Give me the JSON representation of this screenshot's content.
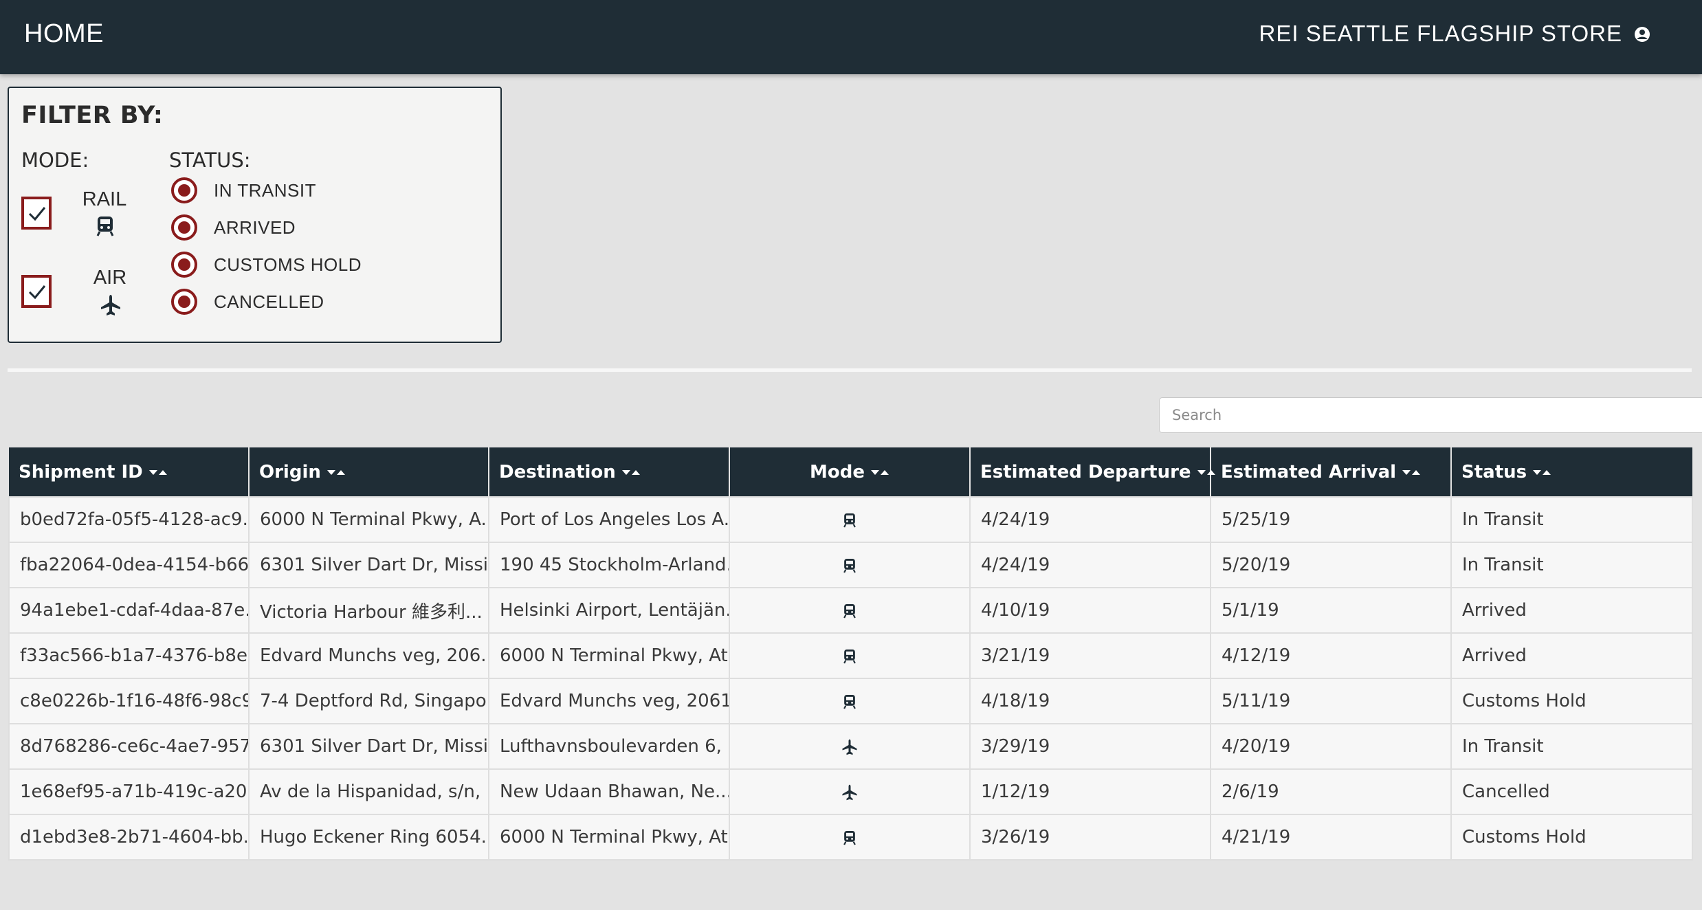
{
  "header": {
    "home_label": "HOME",
    "store_name": "REI SEATTLE FLAGSHIP STORE",
    "user_icon": "user-circle-icon"
  },
  "filter": {
    "title": "FILTER BY:",
    "mode_label": "MODE:",
    "status_label": "STATUS:",
    "modes": [
      {
        "label": "RAIL",
        "icon": "train-icon",
        "checked": true
      },
      {
        "label": "AIR",
        "icon": "airplane-icon",
        "checked": true
      }
    ],
    "statuses": [
      {
        "label": "IN TRANSIT",
        "selected": true
      },
      {
        "label": "ARRIVED",
        "selected": true
      },
      {
        "label": "CUSTOMS HOLD",
        "selected": true
      },
      {
        "label": "CANCELLED",
        "selected": true
      }
    ],
    "accent_color": "#8a1c1c"
  },
  "search": {
    "placeholder": "Search",
    "value": ""
  },
  "table": {
    "columns": [
      "Shipment ID",
      "Origin",
      "Destination",
      "Mode",
      "Estimated Departure",
      "Estimated Arrival",
      "Status"
    ],
    "header_color": "#1f2d36",
    "rows": [
      {
        "id": "b0ed72fa-05f5-4128-ac9...",
        "origin": "6000 N Terminal Pkwy, A...",
        "destination": "Port of Los Angeles Los A...",
        "mode": "rail",
        "departure": "4/24/19",
        "arrival": "5/25/19",
        "status": "In Transit"
      },
      {
        "id": "fba22064-0dea-4154-b66...",
        "origin": "6301 Silver Dart Dr, Missi...",
        "destination": "190 45 Stockholm-Arland...",
        "mode": "rail",
        "departure": "4/24/19",
        "arrival": "5/20/19",
        "status": "In Transit"
      },
      {
        "id": "94a1ebe1-cdaf-4daa-87e...",
        "origin": "Victoria Harbour 維多利...",
        "destination": "Helsinki Airport, Lentäjän...",
        "mode": "rail",
        "departure": "4/10/19",
        "arrival": "5/1/19",
        "status": "Arrived"
      },
      {
        "id": "f33ac566-b1a7-4376-b8e...",
        "origin": "Edvard Munchs veg, 206...",
        "destination": "6000 N Terminal Pkwy, At...",
        "mode": "rail",
        "departure": "3/21/19",
        "arrival": "4/12/19",
        "status": "Arrived"
      },
      {
        "id": "c8e0226b-1f16-48f6-98c9...",
        "origin": "7-4 Deptford Rd, Singapo...",
        "destination": "Edvard Munchs veg, 2061...",
        "mode": "rail",
        "departure": "4/18/19",
        "arrival": "5/11/19",
        "status": "Customs Hold"
      },
      {
        "id": "8d768286-ce6c-4ae7-957...",
        "origin": "6301 Silver Dart Dr, Missi...",
        "destination": "Lufthavnsboulevarden 6, ...",
        "mode": "air",
        "departure": "3/29/19",
        "arrival": "4/20/19",
        "status": "In Transit"
      },
      {
        "id": "1e68ef95-a71b-419c-a20...",
        "origin": "Av de la Hispanidad, s/n, ...",
        "destination": "New Udaan Bhawan, Ne...",
        "mode": "air",
        "departure": "1/12/19",
        "arrival": "2/6/19",
        "status": "Cancelled"
      },
      {
        "id": "d1ebd3e8-2b71-4604-bb...",
        "origin": "Hugo Eckener Ring 6054...",
        "destination": "6000 N Terminal Pkwy, At...",
        "mode": "rail",
        "departure": "3/26/19",
        "arrival": "4/21/19",
        "status": "Customs Hold"
      }
    ]
  }
}
